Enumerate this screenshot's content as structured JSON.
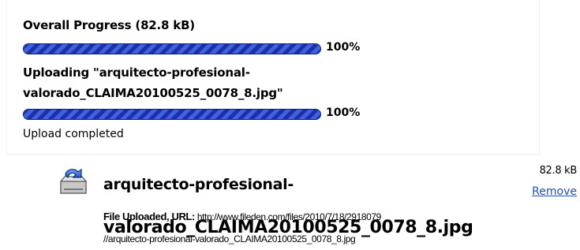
{
  "overall": {
    "title": "Overall Progress (82.8 kB)",
    "progress": 1.0,
    "percent_label": "100%"
  },
  "current_file": {
    "uploading_text": "Uploading \"arquitecto-profesional-valorado_CLAIMA20100525_0078_8.jpg\"",
    "progress": 1.0,
    "percent_label": "100%",
    "status": "Upload completed"
  },
  "uploaded_file": {
    "icon": "file-upload-icon",
    "name_line1": "arquitecto-profesional-",
    "name_line2": "valorado_CLAIMA20100525_0078_8.jpg",
    "size": "82.8 kB",
    "remove_label": "Remove",
    "url_label": "File Uploaded, URL:",
    "url_part1": "http://www.fileden.com/files/2010/7/18/2918079",
    "url_part2": "//arquitecto-profesional-valorado_CLAIMA20100525_0078_8.jpg"
  },
  "colors": {
    "bar_dark": "#1f2fa8",
    "bar_light": "#3f63e0",
    "link": "#1d4fbf"
  }
}
